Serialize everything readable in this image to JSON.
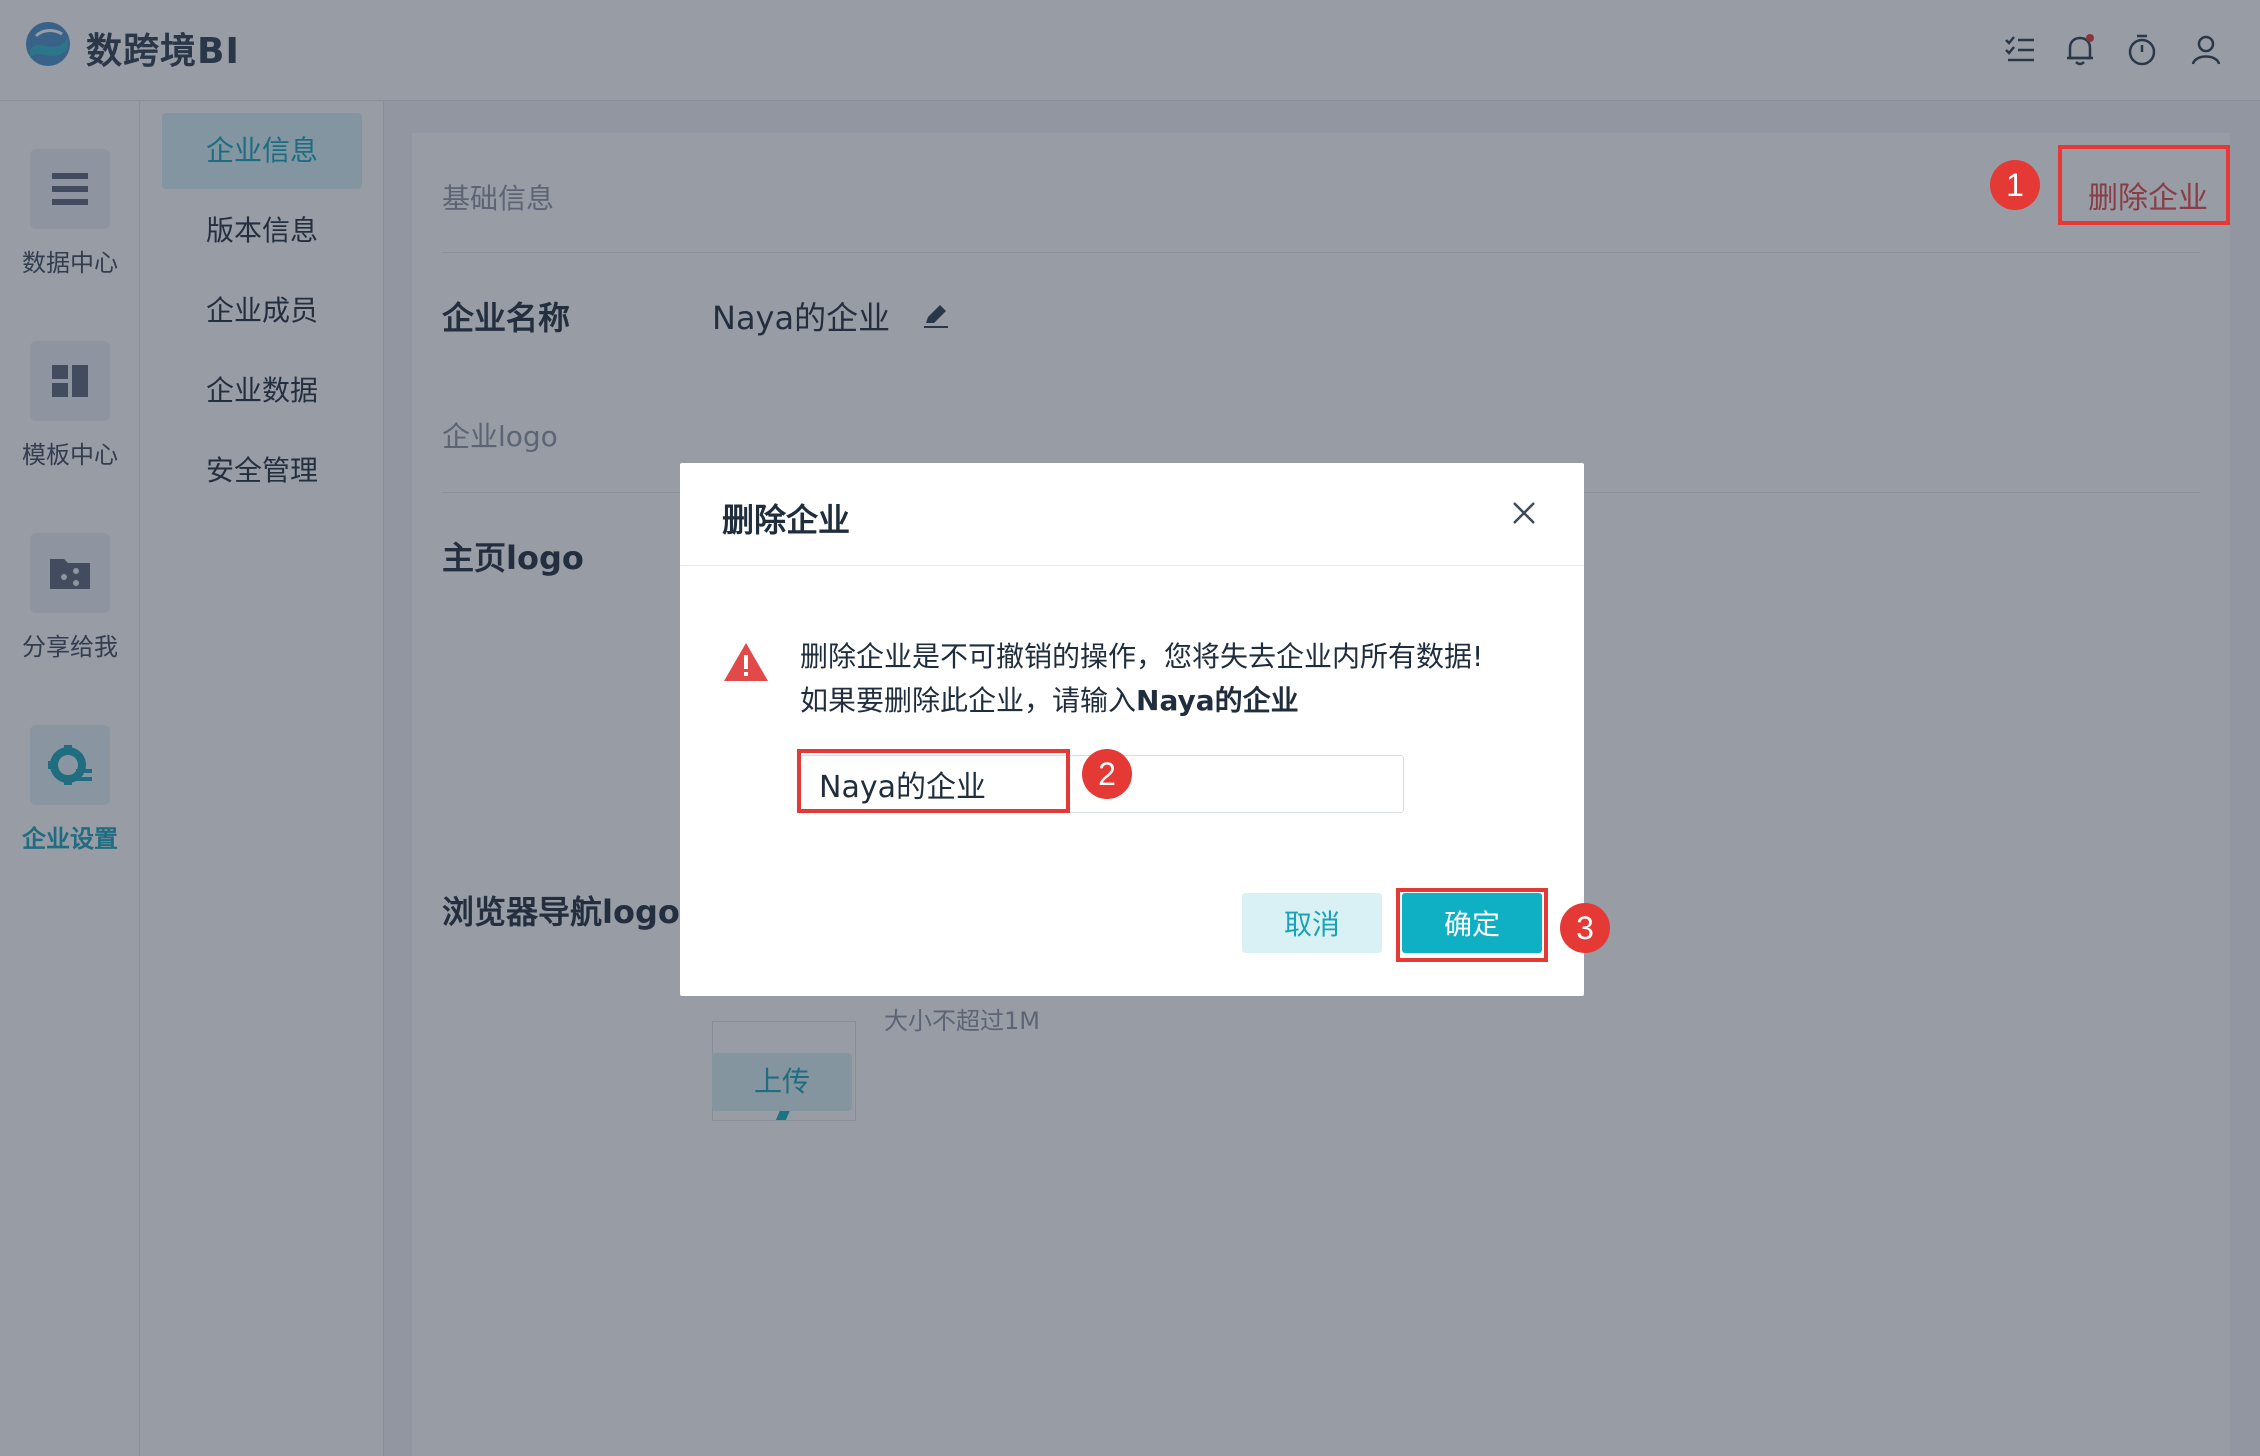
{
  "app": {
    "title": "数跨境BI"
  },
  "topbar": {
    "icons": [
      "task-list-icon",
      "bell-icon",
      "timer-icon",
      "user-icon"
    ],
    "notification_dot_color": "#e53935"
  },
  "rail": {
    "items": [
      {
        "label": "数据中心",
        "icon": "database-icon"
      },
      {
        "label": "模板中心",
        "icon": "template-icon"
      },
      {
        "label": "分享给我",
        "icon": "share-folder-icon"
      },
      {
        "label": "企业设置",
        "icon": "settings-gear-icon",
        "active": true
      }
    ]
  },
  "submenu": {
    "items": [
      {
        "label": "企业信息",
        "active": true
      },
      {
        "label": "版本信息"
      },
      {
        "label": "企业成员"
      },
      {
        "label": "企业数据"
      },
      {
        "label": "安全管理"
      }
    ]
  },
  "main": {
    "section_title": "基础信息",
    "delete_link": "删除企业",
    "company_name_label": "企业名称",
    "company_name_value": "Naya的企业",
    "logo_section_title": "企业logo",
    "home_logo_label": "主页logo",
    "browser_logo_label": "浏览器导航logo",
    "size_hint": "大小不超过1M",
    "upload_label": "上传"
  },
  "modal": {
    "title": "删除企业",
    "message_line1": "删除企业是不可撤销的操作，您将失去企业内所有数据!",
    "message_line2_prefix": "如果要删除此企业，请输入",
    "message_line2_name": "Naya的企业",
    "input_value": "Naya的企业",
    "cancel_label": "取消",
    "confirm_label": "确定"
  },
  "annotations": {
    "steps": [
      "1",
      "2",
      "3"
    ],
    "color": "#e53935"
  },
  "colors": {
    "accent": "#0fb0c4",
    "accent_light": "#d9f1f4",
    "danger": "#e24a4a"
  }
}
